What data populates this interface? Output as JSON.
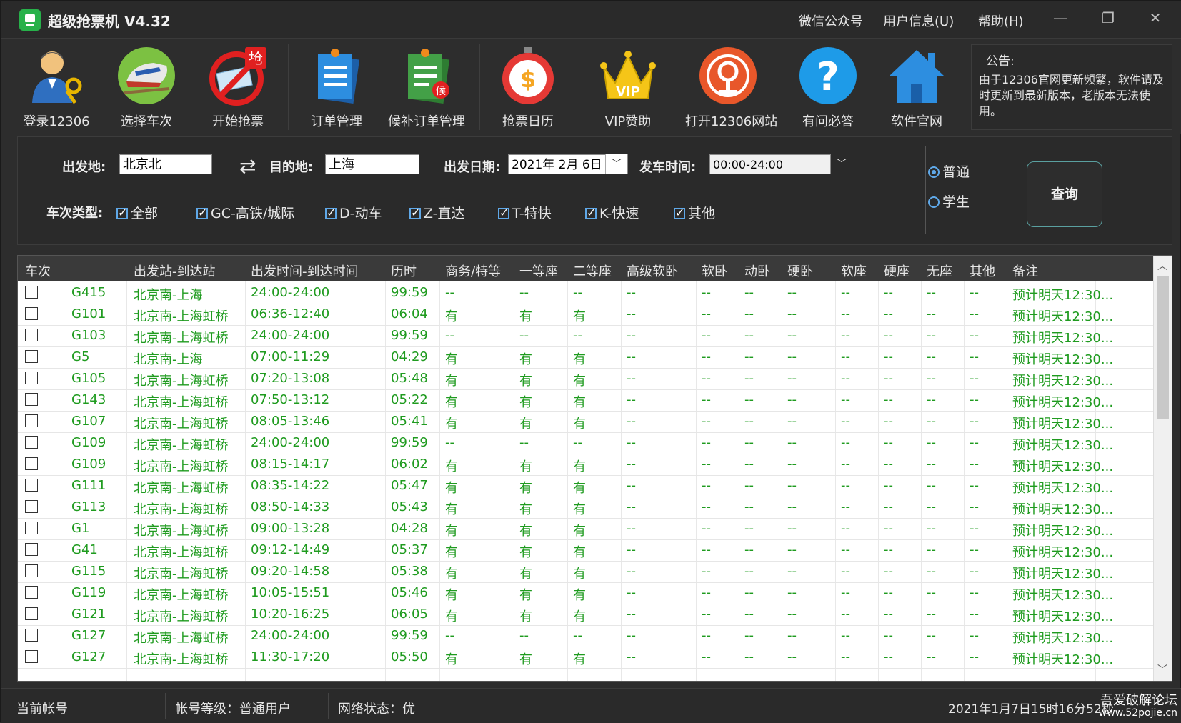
{
  "title_bar": {
    "app_title": "超级抢票机 V4.32",
    "menu": [
      "微信公众号",
      "用户信息(U)",
      "帮助(H)"
    ],
    "window_controls": [
      "minimize-icon",
      "restore-icon",
      "close-icon"
    ]
  },
  "toolbar": {
    "tools": [
      {
        "label": "登录12306",
        "icon": "user-key-icon"
      },
      {
        "label": "选择车次",
        "icon": "train-icon"
      },
      {
        "label": "开始抢票",
        "icon": "grab-ticket-icon"
      },
      {
        "label": "订单管理",
        "icon": "order-icon"
      },
      {
        "label": "候补订单管理",
        "icon": "waitlist-order-icon"
      },
      {
        "label": "抢票日历",
        "icon": "stopwatch-icon"
      },
      {
        "label": "VIP赞助",
        "icon": "crown-icon"
      },
      {
        "label": "打开12306网站",
        "icon": "railway-logo-icon"
      },
      {
        "label": "有问必答",
        "icon": "question-icon"
      },
      {
        "label": "软件官网",
        "icon": "home-icon"
      }
    ],
    "notice": {
      "title": "公告:",
      "body": "由于12306官网更新频繁，软件请及时更新到最新版本，老版本无法使用。"
    }
  },
  "query": {
    "from_label": "出发地:",
    "from_value": "北京北",
    "to_label": "目的地:",
    "to_value": "上海",
    "date_label": "出发日期:",
    "date_value": "2021年  2月  6日",
    "time_label": "发车时间:",
    "time_value": "00:00-24:00",
    "type_label": "车次类型:",
    "train_types": [
      {
        "label": "全部",
        "checked": true
      },
      {
        "label": "GC-高铁/城际",
        "checked": true
      },
      {
        "label": "D-动车",
        "checked": true
      },
      {
        "label": "Z-直达",
        "checked": true
      },
      {
        "label": "T-特快",
        "checked": true
      },
      {
        "label": "K-快速",
        "checked": true
      },
      {
        "label": "其他",
        "checked": true
      }
    ],
    "passenger_types": [
      {
        "label": "普通",
        "selected": true
      },
      {
        "label": "学生",
        "selected": false
      }
    ],
    "search_button": "查询"
  },
  "table": {
    "columns": [
      "车次",
      "出发站-到达站",
      "出发时间-到达时间",
      "历时",
      "商务/特等",
      "一等座",
      "二等座",
      "高级软卧",
      "软卧",
      "动卧",
      "硬卧",
      "软座",
      "硬座",
      "无座",
      "其他",
      "备注"
    ],
    "rows": [
      [
        "G415",
        "北京南-上海",
        "24:00-24:00",
        "99:59",
        "--",
        "--",
        "--",
        "--",
        "--",
        "--",
        "--",
        "--",
        "--",
        "--",
        "--",
        "预计明天12:30..."
      ],
      [
        "G101",
        "北京南-上海虹桥",
        "06:36-12:40",
        "06:04",
        "有",
        "有",
        "有",
        "--",
        "--",
        "--",
        "--",
        "--",
        "--",
        "--",
        "--",
        "预计明天12:30..."
      ],
      [
        "G103",
        "北京南-上海虹桥",
        "24:00-24:00",
        "99:59",
        "--",
        "--",
        "--",
        "--",
        "--",
        "--",
        "--",
        "--",
        "--",
        "--",
        "--",
        "预计明天12:30..."
      ],
      [
        "G5",
        "北京南-上海",
        "07:00-11:29",
        "04:29",
        "有",
        "有",
        "有",
        "--",
        "--",
        "--",
        "--",
        "--",
        "--",
        "--",
        "--",
        "预计明天12:30..."
      ],
      [
        "G105",
        "北京南-上海虹桥",
        "07:20-13:08",
        "05:48",
        "有",
        "有",
        "有",
        "--",
        "--",
        "--",
        "--",
        "--",
        "--",
        "--",
        "--",
        "预计明天12:30..."
      ],
      [
        "G143",
        "北京南-上海虹桥",
        "07:50-13:12",
        "05:22",
        "有",
        "有",
        "有",
        "--",
        "--",
        "--",
        "--",
        "--",
        "--",
        "--",
        "--",
        "预计明天12:30..."
      ],
      [
        "G107",
        "北京南-上海虹桥",
        "08:05-13:46",
        "05:41",
        "有",
        "有",
        "有",
        "--",
        "--",
        "--",
        "--",
        "--",
        "--",
        "--",
        "--",
        "预计明天12:30..."
      ],
      [
        "G109",
        "北京南-上海虹桥",
        "24:00-24:00",
        "99:59",
        "--",
        "--",
        "--",
        "--",
        "--",
        "--",
        "--",
        "--",
        "--",
        "--",
        "--",
        "预计明天12:30..."
      ],
      [
        "G109",
        "北京南-上海虹桥",
        "08:15-14:17",
        "06:02",
        "有",
        "有",
        "有",
        "--",
        "--",
        "--",
        "--",
        "--",
        "--",
        "--",
        "--",
        "预计明天12:30..."
      ],
      [
        "G111",
        "北京南-上海虹桥",
        "08:35-14:22",
        "05:47",
        "有",
        "有",
        "有",
        "--",
        "--",
        "--",
        "--",
        "--",
        "--",
        "--",
        "--",
        "预计明天12:30..."
      ],
      [
        "G113",
        "北京南-上海虹桥",
        "08:50-14:33",
        "05:43",
        "有",
        "有",
        "有",
        "--",
        "--",
        "--",
        "--",
        "--",
        "--",
        "--",
        "--",
        "预计明天12:30..."
      ],
      [
        "G1",
        "北京南-上海虹桥",
        "09:00-13:28",
        "04:28",
        "有",
        "有",
        "有",
        "--",
        "--",
        "--",
        "--",
        "--",
        "--",
        "--",
        "--",
        "预计明天12:30..."
      ],
      [
        "G41",
        "北京南-上海虹桥",
        "09:12-14:49",
        "05:37",
        "有",
        "有",
        "有",
        "--",
        "--",
        "--",
        "--",
        "--",
        "--",
        "--",
        "--",
        "预计明天12:30..."
      ],
      [
        "G115",
        "北京南-上海虹桥",
        "09:20-14:58",
        "05:38",
        "有",
        "有",
        "有",
        "--",
        "--",
        "--",
        "--",
        "--",
        "--",
        "--",
        "--",
        "预计明天12:30..."
      ],
      [
        "G119",
        "北京南-上海虹桥",
        "10:05-15:51",
        "05:46",
        "有",
        "有",
        "有",
        "--",
        "--",
        "--",
        "--",
        "--",
        "--",
        "--",
        "--",
        "预计明天12:30..."
      ],
      [
        "G121",
        "北京南-上海虹桥",
        "10:20-16:25",
        "06:05",
        "有",
        "有",
        "有",
        "--",
        "--",
        "--",
        "--",
        "--",
        "--",
        "--",
        "--",
        "预计明天12:30..."
      ],
      [
        "G127",
        "北京南-上海虹桥",
        "24:00-24:00",
        "99:59",
        "--",
        "--",
        "--",
        "--",
        "--",
        "--",
        "--",
        "--",
        "--",
        "--",
        "--",
        "预计明天12:30..."
      ],
      [
        "G127",
        "北京南-上海虹桥",
        "11:30-17:20",
        "05:50",
        "有",
        "有",
        "有",
        "--",
        "--",
        "--",
        "--",
        "--",
        "--",
        "--",
        "--",
        "预计明天12:30..."
      ]
    ]
  },
  "status_bar": {
    "account_label": "当前帐号",
    "level_text": "帐号等级：普通用户",
    "network_text": "网络状态：优",
    "datetime_text": "2021年1月7日15时16分52秒",
    "watermark": "吾爱破解论坛",
    "watermark_url": "www.52pojie.cn"
  },
  "colors": {
    "background": "#2d2d2d",
    "table_text": "#1f9b1f",
    "accent": "#5fa8e8"
  }
}
